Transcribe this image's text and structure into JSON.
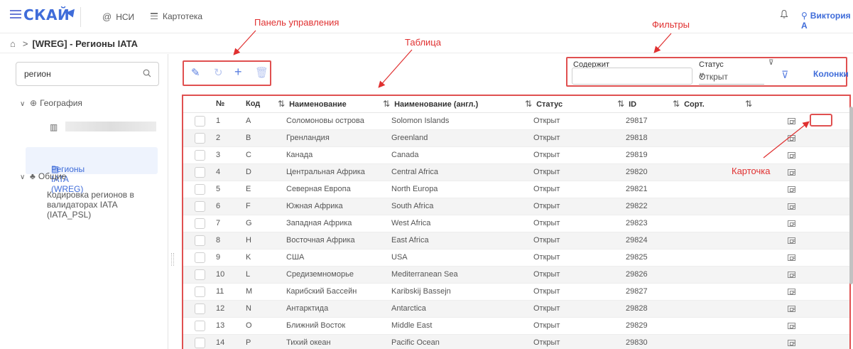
{
  "topbar": {
    "logo": "СКАЙ",
    "nav": [
      {
        "label": "НСИ",
        "icon": "at-icon"
      },
      {
        "label": "Картотека",
        "icon": "list-icon"
      }
    ],
    "user": "Виктория А",
    "icons": [
      "menu-icon",
      "bell-icon",
      "user-icon"
    ]
  },
  "breadcrumb": {
    "separator": ">",
    "title": "[WREG] - Регионы IATA"
  },
  "sidebar": {
    "search": {
      "value": "регион",
      "placeholder": ""
    },
    "tree": [
      {
        "label": "География",
        "icon": "globe-icon",
        "expanded": true
      },
      {
        "label": "",
        "icon": "book-icon",
        "note": "obscured"
      },
      {
        "label": "Регионы IATA (WREG)",
        "icon": "book-icon",
        "selected": true
      },
      {
        "label": "Общие",
        "icon": "hierarchy-icon",
        "expanded": true
      },
      {
        "label": "Кодировка регионов в валидаторах IATA (IATA_PSL)"
      }
    ]
  },
  "toolbar": {
    "icons": [
      "edit-icon",
      "refresh-icon",
      "add-icon",
      "delete-icon"
    ]
  },
  "filters": {
    "contains_label": "Содержит",
    "contains_value": "",
    "status_label": "Статус",
    "status_value": "Открыт",
    "columns_label": "Колонки"
  },
  "table": {
    "columns": [
      "№",
      "Код",
      "Наименование",
      "Наименование (англ.)",
      "Статус",
      "ID",
      "Сорт."
    ],
    "sort_icon": "⇅",
    "rows": [
      {
        "n": "1",
        "code": "A",
        "name": "Соломоновы острова",
        "name_en": "Solomon Islands",
        "status": "Открыт",
        "id": "29817",
        "sort": ""
      },
      {
        "n": "2",
        "code": "B",
        "name": "Гренландия",
        "name_en": "Greenland",
        "status": "Открыт",
        "id": "29818",
        "sort": ""
      },
      {
        "n": "3",
        "code": "C",
        "name": "Канада",
        "name_en": "Canada",
        "status": "Открыт",
        "id": "29819",
        "sort": ""
      },
      {
        "n": "4",
        "code": "D",
        "name": "Центральная Африка",
        "name_en": "Central Africa",
        "status": "Открыт",
        "id": "29820",
        "sort": ""
      },
      {
        "n": "5",
        "code": "E",
        "name": "Северная Европа",
        "name_en": "North Europa",
        "status": "Открыт",
        "id": "29821",
        "sort": ""
      },
      {
        "n": "6",
        "code": "F",
        "name": "Южная Африка",
        "name_en": "South Africa",
        "status": "Открыт",
        "id": "29822",
        "sort": ""
      },
      {
        "n": "7",
        "code": "G",
        "name": "Западная Африка",
        "name_en": "West Africa",
        "status": "Открыт",
        "id": "29823",
        "sort": ""
      },
      {
        "n": "8",
        "code": "H",
        "name": "Восточная Африка",
        "name_en": "East Africa",
        "status": "Открыт",
        "id": "29824",
        "sort": ""
      },
      {
        "n": "9",
        "code": "K",
        "name": "США",
        "name_en": "USA",
        "status": "Открыт",
        "id": "29825",
        "sort": ""
      },
      {
        "n": "10",
        "code": "L",
        "name": "Средиземноморье",
        "name_en": "Mediterranean Sea",
        "status": "Открыт",
        "id": "29826",
        "sort": ""
      },
      {
        "n": "11",
        "code": "M",
        "name": "Карибский Бассейн",
        "name_en": "Karibskij Bassejn",
        "status": "Открыт",
        "id": "29827",
        "sort": ""
      },
      {
        "n": "12",
        "code": "N",
        "name": "Антарктида",
        "name_en": "Antarctica",
        "status": "Открыт",
        "id": "29828",
        "sort": ""
      },
      {
        "n": "13",
        "code": "O",
        "name": "Ближний Восток",
        "name_en": "Middle East",
        "status": "Открыт",
        "id": "29829",
        "sort": ""
      },
      {
        "n": "14",
        "code": "P",
        "name": "Тихий океан",
        "name_en": "Pacific Ocean",
        "status": "Открыт",
        "id": "29830",
        "sort": ""
      }
    ]
  },
  "annotations": {
    "control_panel": "Панель управления",
    "table": "Таблица",
    "filters": "Фильтры",
    "card": "Карточка"
  },
  "colors": {
    "accent": "#3f6cd9",
    "annotation": "#e05050",
    "selected_bg": "#eef3fd"
  }
}
